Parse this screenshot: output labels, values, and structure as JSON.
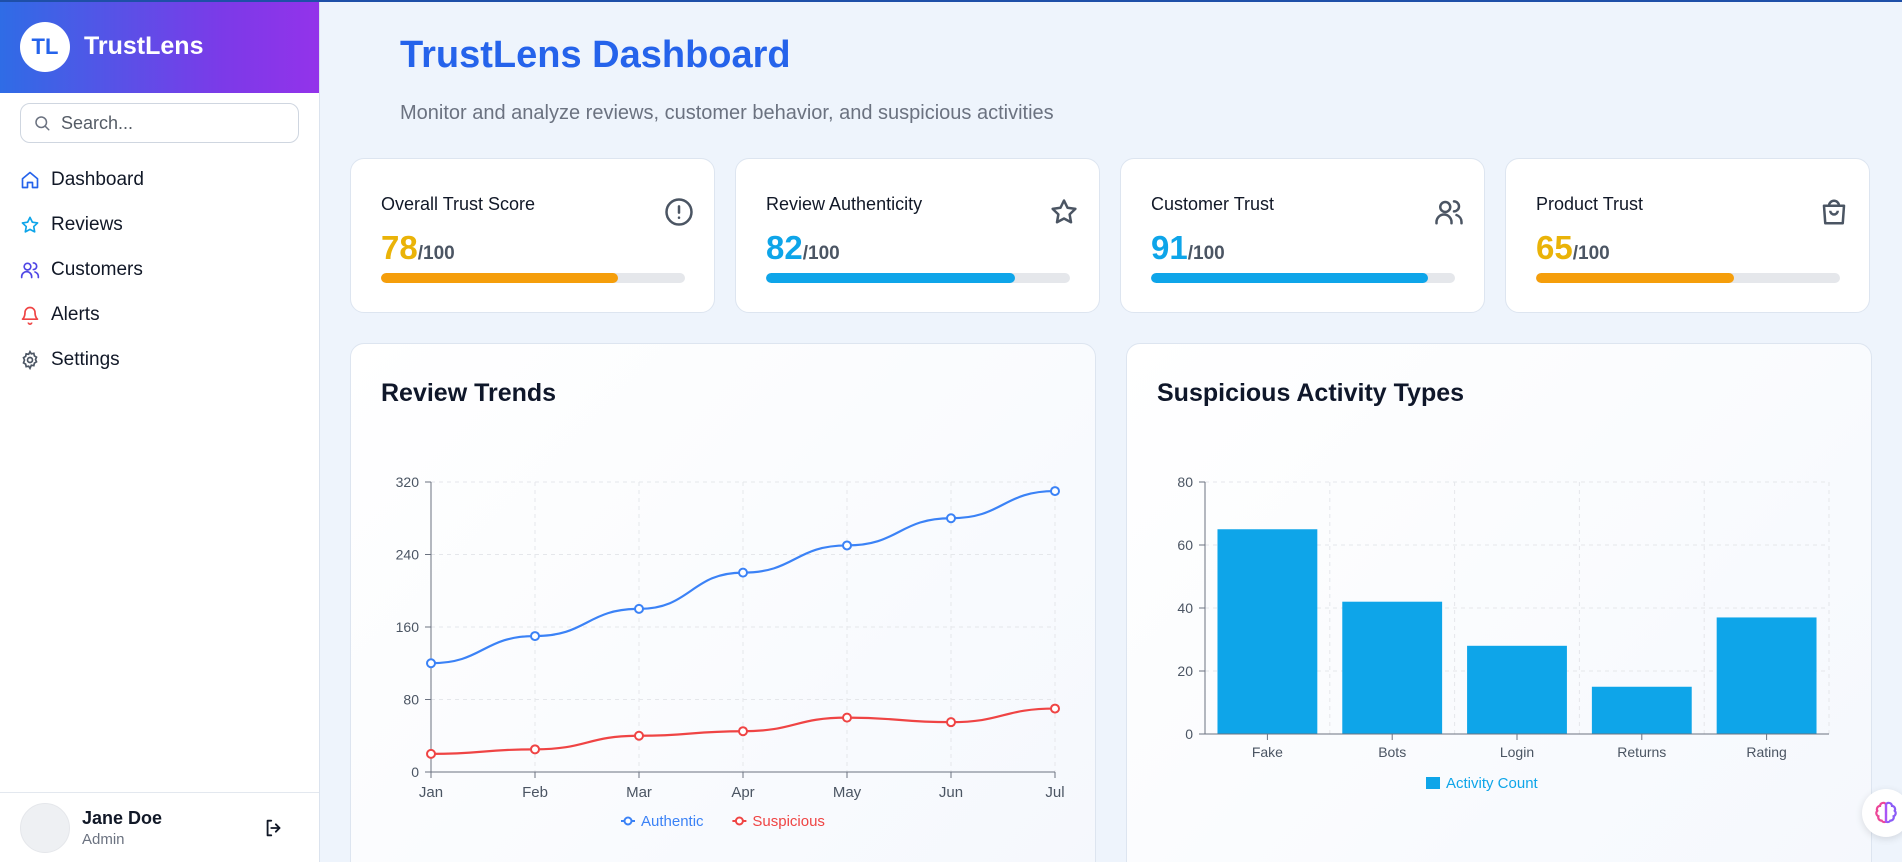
{
  "brand": {
    "logo": "TL",
    "name": "TrustLens"
  },
  "search": {
    "placeholder": "Search..."
  },
  "nav": [
    {
      "label": "Dashboard",
      "icon": "home-icon",
      "color": "#2563eb"
    },
    {
      "label": "Reviews",
      "icon": "star-icon",
      "color": "#0ea5e9"
    },
    {
      "label": "Customers",
      "icon": "users-icon",
      "color": "#4f46e5"
    },
    {
      "label": "Alerts",
      "icon": "bell-icon",
      "color": "#ef4444"
    },
    {
      "label": "Settings",
      "icon": "gear-icon",
      "color": "#4b5563"
    }
  ],
  "user": {
    "name": "Jane Doe",
    "role": "Admin"
  },
  "header": {
    "title": "TrustLens Dashboard",
    "subtitle": "Monitor and analyze reviews, customer behavior, and suspicious activities"
  },
  "kpis": [
    {
      "label": "Overall Trust Score",
      "value": "78",
      "denom": "/100",
      "progress": 0.78,
      "color": "#eab308",
      "bar_color": "#f59e0b",
      "icon": "alert-circle-icon"
    },
    {
      "label": "Review Authenticity",
      "value": "82",
      "denom": "/100",
      "progress": 0.82,
      "color": "#0ea5e9",
      "bar_color": "#0ea5e9",
      "icon": "star-icon"
    },
    {
      "label": "Customer Trust",
      "value": "91",
      "denom": "/100",
      "progress": 0.91,
      "color": "#0ea5e9",
      "bar_color": "#0ea5e9",
      "icon": "users-icon"
    },
    {
      "label": "Product Trust",
      "value": "65",
      "denom": "/100",
      "progress": 0.65,
      "color": "#eab308",
      "bar_color": "#f59e0b",
      "icon": "shopping-bag-icon"
    }
  ],
  "panels": {
    "trends_title": "Review Trends",
    "activity_title": "Suspicious Activity Types"
  },
  "chart_data": [
    {
      "type": "line",
      "title": "Review Trends",
      "categories": [
        "Jan",
        "Feb",
        "Mar",
        "Apr",
        "May",
        "Jun",
        "Jul"
      ],
      "series": [
        {
          "name": "Authentic",
          "values": [
            120,
            150,
            180,
            220,
            250,
            280,
            310
          ],
          "color": "#3b82f6"
        },
        {
          "name": "Suspicious",
          "values": [
            20,
            25,
            40,
            45,
            60,
            55,
            70
          ],
          "color": "#ef4444"
        }
      ],
      "yticks": [
        0,
        80,
        160,
        240,
        320
      ],
      "ylim": [
        0,
        320
      ],
      "grid": true,
      "legend": "bottom"
    },
    {
      "type": "bar",
      "title": "Suspicious Activity Types",
      "categories": [
        "Fake",
        "Bots",
        "Login",
        "Returns",
        "Rating"
      ],
      "series": [
        {
          "name": "Activity Count",
          "values": [
            65,
            42,
            28,
            15,
            37
          ],
          "color": "#0ea5e9"
        }
      ],
      "yticks": [
        0,
        20,
        40,
        60,
        80
      ],
      "ylim": [
        0,
        80
      ],
      "grid": true,
      "legend": "bottom"
    }
  ]
}
